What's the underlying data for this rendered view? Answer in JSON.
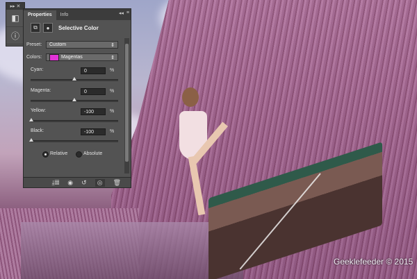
{
  "panel": {
    "tabs": [
      {
        "label": "Properties",
        "active": true
      },
      {
        "label": "Info",
        "active": false
      }
    ],
    "title": "Selective Color",
    "preset": {
      "label": "Preset:",
      "value": "Custom"
    },
    "colors": {
      "label": "Colors:",
      "value": "Magentas",
      "swatch": "#e233d6"
    },
    "sliders": [
      {
        "label": "Cyan:",
        "value": "0",
        "unit": "%",
        "level": 0.5
      },
      {
        "label": "Magenta:",
        "value": "0",
        "unit": "%",
        "level": 0.5
      },
      {
        "label": "Yellow:",
        "value": "-100",
        "unit": "%",
        "level": 0.0
      },
      {
        "label": "Black:",
        "value": "-100",
        "unit": "%",
        "level": 0.0
      }
    ],
    "method": {
      "relative": "Relative",
      "absolute": "Absolute",
      "selected": "relative"
    }
  },
  "photo": {
    "watermark": "Geeklefeeder © 2015"
  }
}
